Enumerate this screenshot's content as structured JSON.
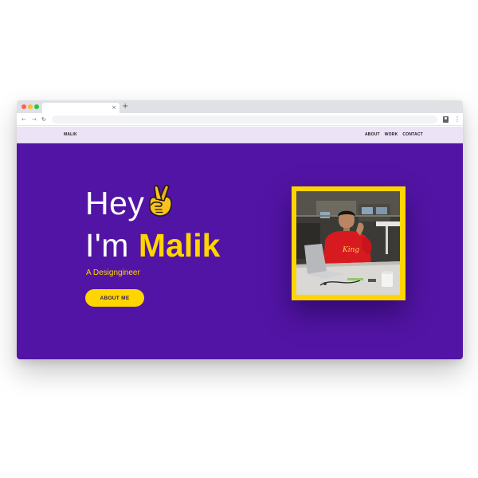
{
  "browser": {
    "tab_close_glyph": "×",
    "new_tab_glyph": "+",
    "back_glyph": "←",
    "forward_glyph": "→",
    "reload_glyph": "↻",
    "menu_glyph": "⋮",
    "url": ""
  },
  "site": {
    "logo": "MALIK",
    "nav": [
      {
        "label": "ABOUT"
      },
      {
        "label": "WORK"
      },
      {
        "label": "CONTACT"
      }
    ]
  },
  "hero": {
    "greeting": "Hey",
    "intro": "I'm",
    "name": "Malik",
    "tagline": "A Designgineer",
    "cta_label": "ABOUT ME",
    "emoji_icon": "crossed-fingers-icon",
    "photo_shirt_text": "King"
  },
  "colors": {
    "hero_background": "#5214a4",
    "accent_yellow": "#ffd500",
    "nav_background": "#ece3f7"
  }
}
